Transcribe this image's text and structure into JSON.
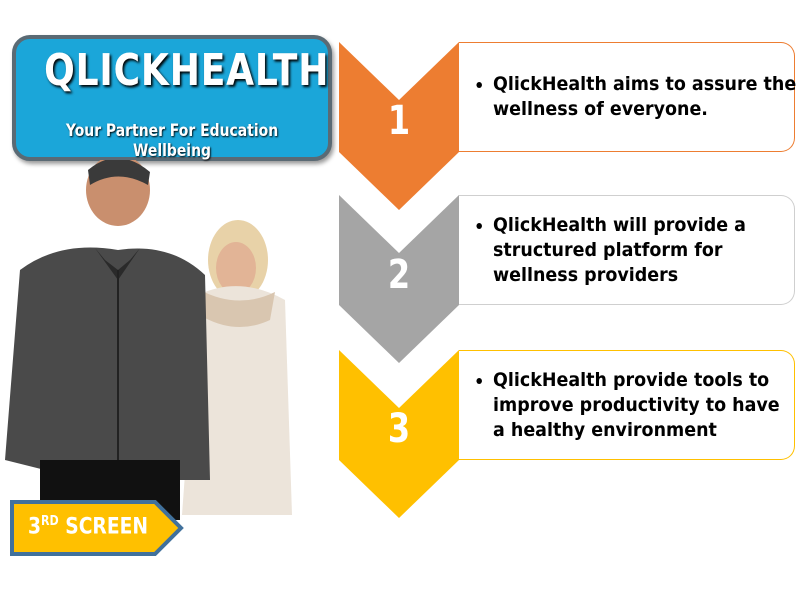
{
  "logo": {
    "title": "QLICKHEALTH",
    "subtitle": "Your Partner For Education Wellbeing"
  },
  "steps": [
    {
      "number": "1",
      "text": "QlickHealth aims to assure the wellness of everyone.",
      "color": "#ed7d31"
    },
    {
      "number": "2",
      "text": "QlickHealth will provide a structured platform for wellness providers",
      "color": "#a5a5a5"
    },
    {
      "number": "3",
      "text": "QlickHealth provide tools to improve productivity to have a healthy environment",
      "color": "#ffc000"
    }
  ],
  "badge": {
    "ordinal": "3",
    "suffix": "RD",
    "label": "SCREEN",
    "color": "#ffc000",
    "border": "#41719c"
  }
}
